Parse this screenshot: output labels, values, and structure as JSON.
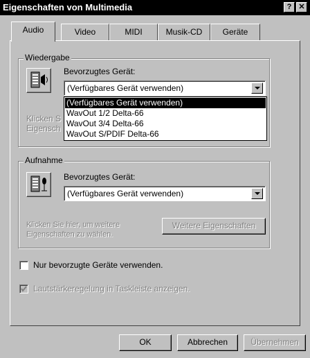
{
  "window": {
    "title": "Eigenschaften von Multimedia",
    "help_glyph": "?",
    "close_glyph": "✕"
  },
  "tabs": [
    {
      "label": "Audio",
      "active": true
    },
    {
      "label": "Video"
    },
    {
      "label": "MIDI"
    },
    {
      "label": "Musik-CD"
    },
    {
      "label": "Geräte"
    }
  ],
  "playback": {
    "group_label": "Wiedergabe",
    "preferred_label": "Bevorzugtes Gerät:",
    "selected_value": "(Verfügbares Gerät verwenden)",
    "options": [
      "(Verfügbares Gerät verwenden)",
      "WavOut 1/2 Delta-66",
      "WavOut 3/4 Delta-66",
      "WavOut S/PDIF Delta-66"
    ],
    "hidden_hint_line1": "Klicken S",
    "hidden_hint_line2": "Eigensch",
    "icon": "speaker-icon"
  },
  "recording": {
    "group_label": "Aufnahme",
    "preferred_label": "Bevorzugtes Gerät:",
    "selected_value": "(Verfügbares Gerät verwenden)",
    "hint_line1": "Klicken Sie hier, um weitere",
    "hint_line2": "Eigenschaften zu wählen.",
    "more_button": "Weitere Eigenschaften",
    "icon": "microphone-icon"
  },
  "options": {
    "preferred_only": "Nur bevorzugte Geräte verwenden.",
    "volume_taskbar": "Lautstärkeregelung in Taskleiste anzeigen."
  },
  "footer": {
    "ok": "OK",
    "cancel": "Abbrechen",
    "apply": "Übernehmen"
  }
}
